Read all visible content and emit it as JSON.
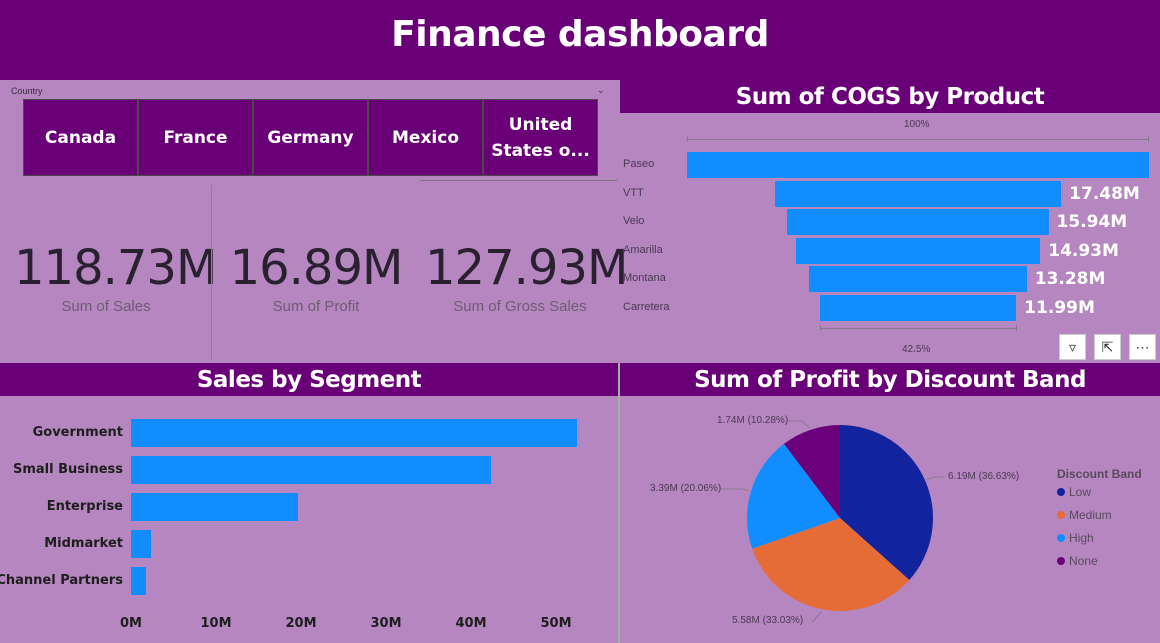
{
  "title": "Finance dashboard",
  "slicer": {
    "label": "Country",
    "items": [
      "Canada",
      "France",
      "Germany",
      "Mexico",
      "United States o..."
    ]
  },
  "kpis": [
    {
      "value": "118.73M",
      "label": "Sum of  Sales"
    },
    {
      "value": "16.89M",
      "label": "Sum of Profit"
    },
    {
      "value": "127.93M",
      "label": "Sum of Gross Sales"
    }
  ],
  "cogs": {
    "title": "Sum of COGS by Product",
    "top_pct": "100%",
    "bottom_pct": "42.5%",
    "products": [
      {
        "name": "Paseo",
        "value": 28.21,
        "label": ""
      },
      {
        "name": "VTT",
        "value": 17.48,
        "label": "17.48M"
      },
      {
        "name": "Velo",
        "value": 15.94,
        "label": "15.94M"
      },
      {
        "name": "Amarilla",
        "value": 14.93,
        "label": "14.93M"
      },
      {
        "name": "Montana",
        "value": 13.28,
        "label": "13.28M"
      },
      {
        "name": "Carretera",
        "value": 11.99,
        "label": "11.99M"
      }
    ]
  },
  "segment": {
    "title": "Sales by Segment",
    "ticks": [
      "0M",
      "10M",
      "20M",
      "30M",
      "40M",
      "50M"
    ],
    "max": 53,
    "rows": [
      {
        "name": "Government",
        "value": 52.5
      },
      {
        "name": "Small Business",
        "value": 42.4
      },
      {
        "name": "Enterprise",
        "value": 19.6
      },
      {
        "name": "Midmarket",
        "value": 2.4
      },
      {
        "name": "Channel Partners",
        "value": 1.8
      }
    ]
  },
  "discount": {
    "title": "Sum of Profit by Discount Band",
    "legend_title": "Discount Band",
    "slices": [
      {
        "name": "Low",
        "value": 6.19,
        "label": "6.19M (36.63%)",
        "color": "#12239e"
      },
      {
        "name": "Medium",
        "value": 5.58,
        "label": "5.58M (33.03%)",
        "color": "#e66c37"
      },
      {
        "name": "High",
        "value": 3.39,
        "label": "3.39M (20.06%)",
        "color": "#118dff"
      },
      {
        "name": "None",
        "value": 1.74,
        "label": "1.74M (10.28%)",
        "color": "#6b007b"
      }
    ]
  }
}
